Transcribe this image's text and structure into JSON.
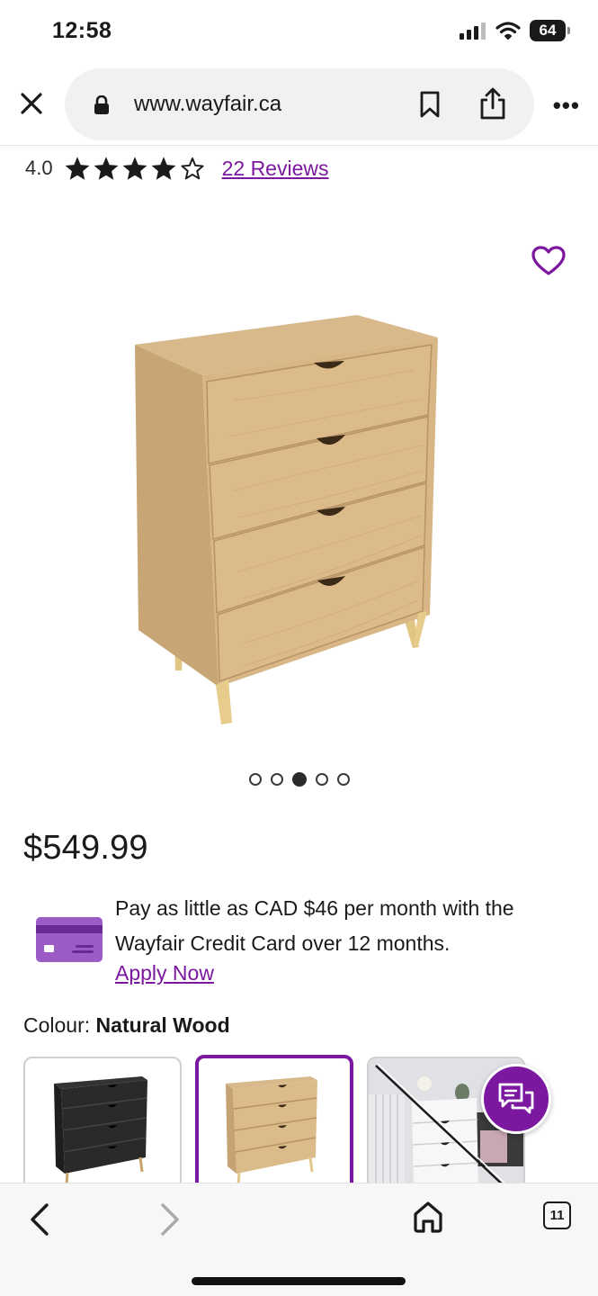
{
  "status_bar": {
    "time": "12:58",
    "battery": "64",
    "icons": [
      "signal-icon",
      "wifi-icon",
      "battery-icon"
    ]
  },
  "browser": {
    "url": "www.wayfair.ca",
    "icons": [
      "close-icon",
      "lock-icon",
      "bookmark-icon",
      "share-icon",
      "more-icon"
    ],
    "more_label": "•••"
  },
  "product": {
    "rating_value": "4.0",
    "rating_stars": 4,
    "rating_max": 5,
    "reviews_label": "22 Reviews",
    "price": "$549.99",
    "image_count": 5,
    "active_image": 3,
    "credit_text": "Pay as little as CAD $46 per month with the Wayfair Credit Card over 12 months.",
    "apply_label": "Apply Now",
    "colour_label": "Colour:",
    "colour_value": "Natural Wood",
    "swatches": [
      "Black",
      "Natural Wood",
      "White"
    ],
    "selected_swatch": "Natural Wood"
  },
  "toolbar": {
    "tabs_count": "11",
    "icons": [
      "back-icon",
      "forward-icon",
      "home-icon",
      "tabs-icon"
    ]
  },
  "colors": {
    "brand_purple": "#7b189f",
    "wood": "#d9b483",
    "text": "#1a1a1a"
  }
}
